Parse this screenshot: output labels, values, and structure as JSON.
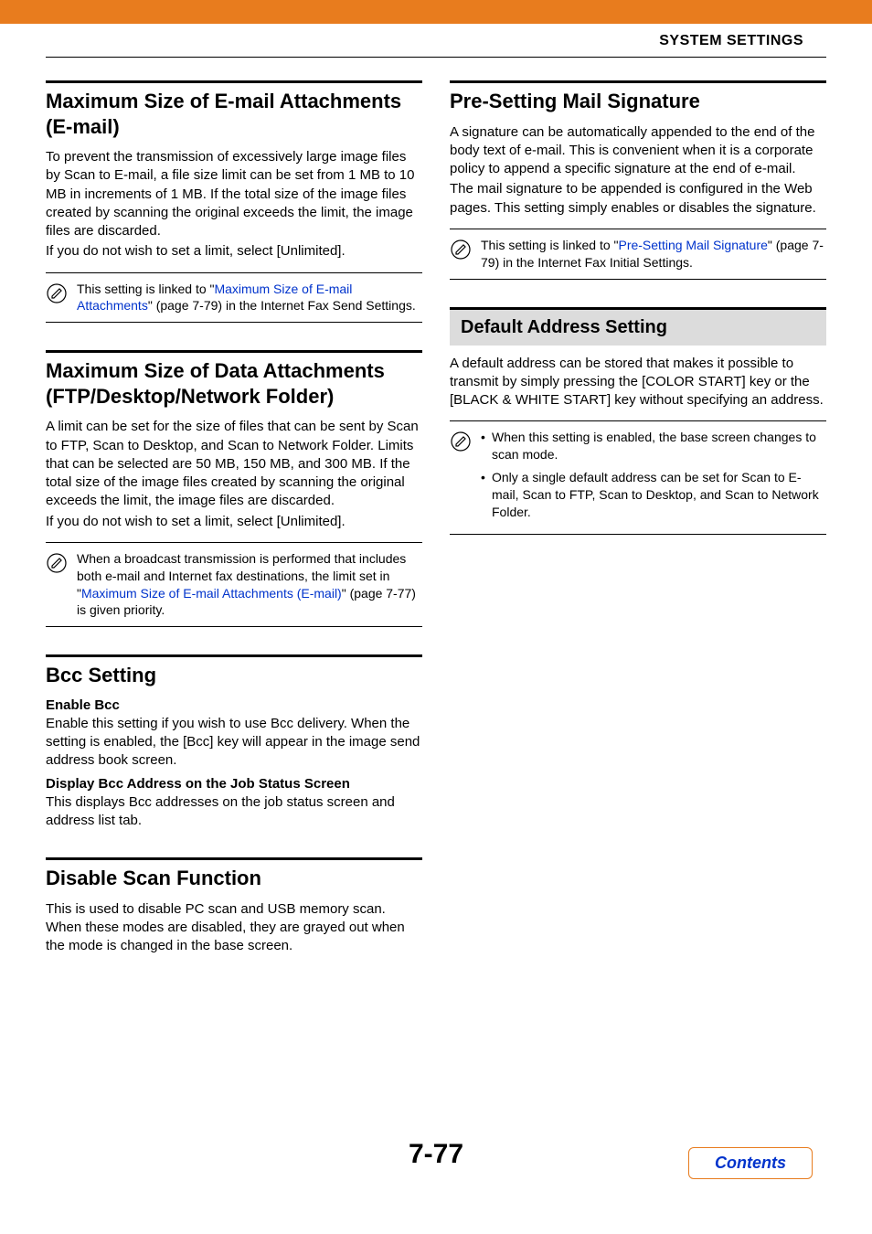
{
  "header": {
    "title": "SYSTEM SETTINGS"
  },
  "left": {
    "s1": {
      "title": "Maximum Size of E-mail Attachments (E-mail)",
      "p1": "To prevent the transmission of excessively large image files by Scan to E-mail, a file size limit can be set from 1 MB to 10 MB in increments of 1 MB. If the total size of the image files created by scanning the original exceeds the limit, the image files are discarded.",
      "p2": "If you do not wish to set a limit, select [Unlimited].",
      "note_pre": "This setting is linked to \"",
      "note_link": "Maximum Size of E-mail Attachments",
      "note_post": "\" (page 7-79) in the Internet Fax Send Settings."
    },
    "s2": {
      "title": "Maximum Size of Data Attachments (FTP/Desktop/Network Folder)",
      "p1": "A limit can be set for the size of files that can be sent by Scan to FTP, Scan to Desktop, and Scan to Network Folder. Limits that can be selected are 50 MB, 150 MB, and 300 MB. If the total size of the image files created by scanning the original exceeds the limit, the image files are discarded.",
      "p2": "If you do not wish to set a limit, select [Unlimited].",
      "note_pre": "When a broadcast transmission is performed that includes both e-mail and Internet fax destinations, the limit set in \"",
      "note_link": "Maximum Size of E-mail Attachments (E-mail)",
      "note_post": "\" (page 7-77) is given priority."
    },
    "s3": {
      "title": "Bcc Setting",
      "sub1": "Enable Bcc",
      "sub1_text": "Enable this setting if you wish to use Bcc delivery. When the setting is enabled, the [Bcc] key will appear in the image send address book screen.",
      "sub2": "Display Bcc Address on the Job Status Screen",
      "sub2_text": "This displays Bcc addresses on the job status screen and address list tab."
    },
    "s4": {
      "title": "Disable Scan Function",
      "p1": "This is used to disable PC scan and USB memory scan. When these modes are disabled, they are grayed out when the mode is changed in the base screen."
    }
  },
  "right": {
    "s1": {
      "title": "Pre-Setting Mail Signature",
      "p1": "A signature can be automatically appended to the end of the body text of e-mail. This is convenient when it is a corporate policy to append a specific signature at the end of e-mail.",
      "p2": "The mail signature to be appended is configured in the Web pages. This setting simply enables or disables the signature.",
      "note_pre": "This setting is linked to \"",
      "note_link": "Pre-Setting Mail Signature",
      "note_post": "\" (page 7-79) in the Internet Fax Initial Settings."
    },
    "s2": {
      "title": "Default Address Setting",
      "p1": "A default address can be stored that makes it possible to transmit by simply pressing the [COLOR START] key or the [BLACK & WHITE START] key without specifying an address.",
      "b1": "When this setting is enabled, the base screen changes to scan mode.",
      "b2": "Only a single default address can be set for Scan to E-mail, Scan to FTP, Scan to Desktop, and Scan to Network Folder."
    }
  },
  "footer": {
    "page": "7-77",
    "contents": "Contents"
  }
}
